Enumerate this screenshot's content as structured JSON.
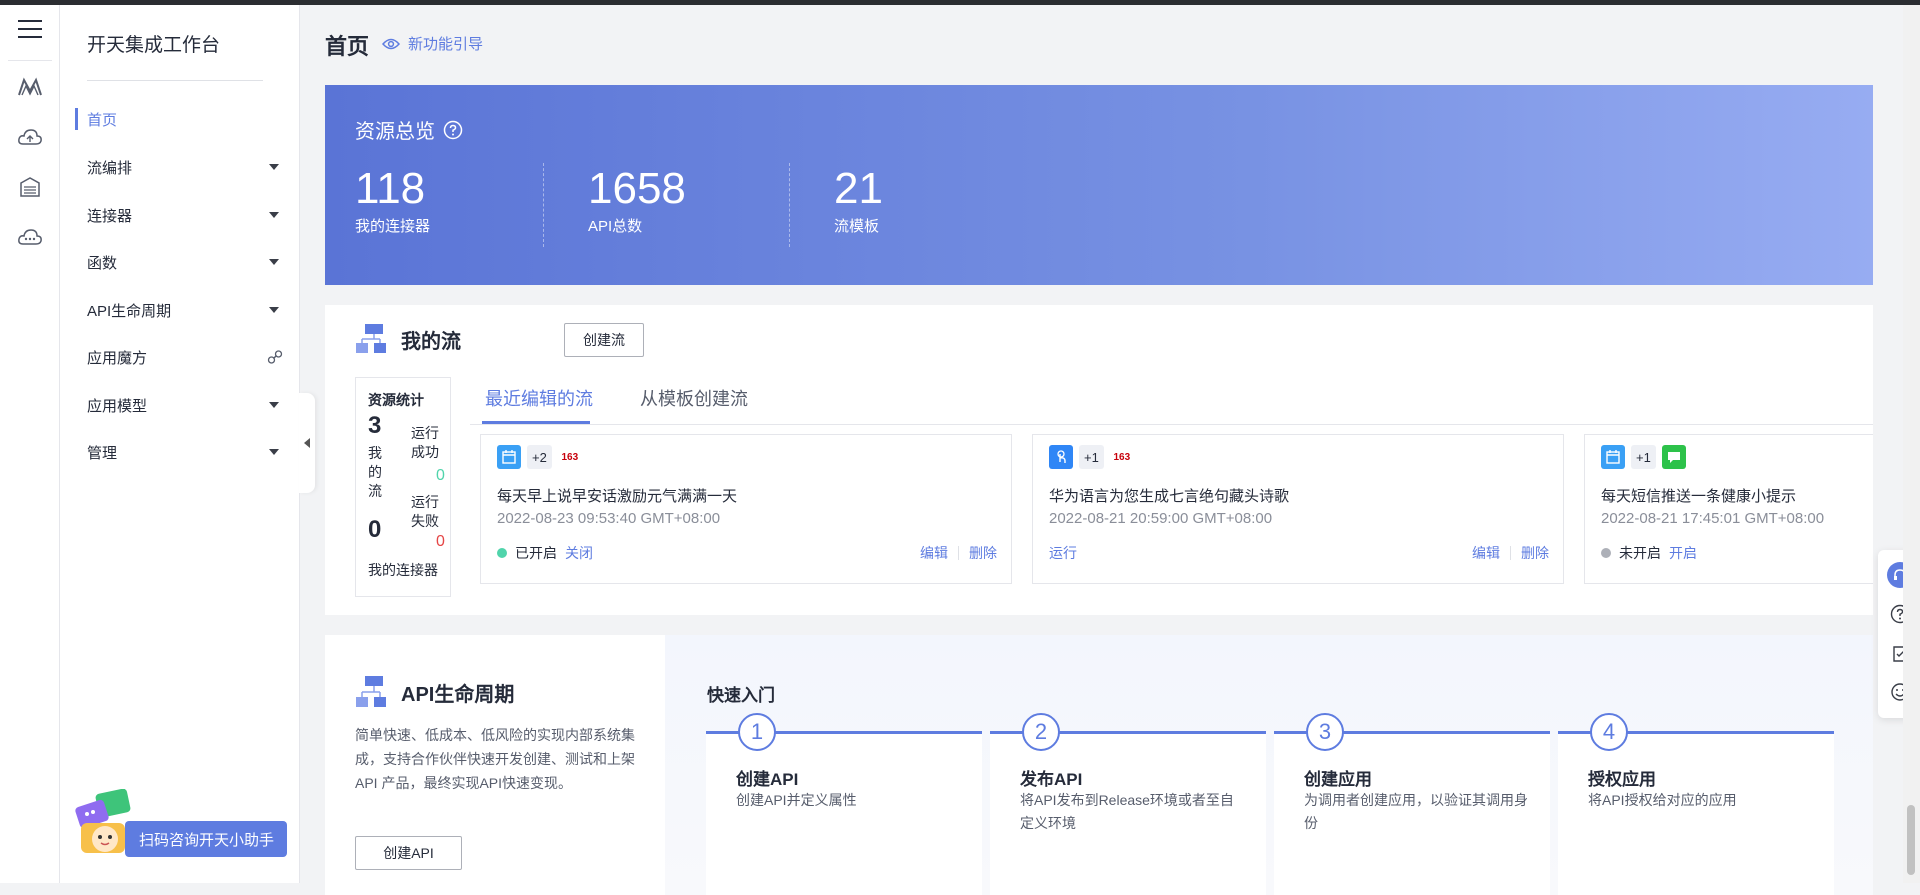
{
  "rail": {
    "icons": [
      "hamburger-icon",
      "m-logo-icon",
      "cloud-upload-icon",
      "server-icon",
      "cloud-icon"
    ]
  },
  "menu": {
    "title": "开天集成工作台",
    "items": [
      {
        "label": "首页"
      },
      {
        "label": "流编排"
      },
      {
        "label": "连接器"
      },
      {
        "label": "函数"
      },
      {
        "label": "API生命周期"
      },
      {
        "label": "应用魔方"
      },
      {
        "label": "应用模型"
      },
      {
        "label": "管理"
      }
    ],
    "assistant": "扫码咨询开天小助手"
  },
  "header": {
    "title": "首页",
    "guide": "新功能引导"
  },
  "overview": {
    "title": "资源总览",
    "stats": [
      {
        "value": "118",
        "label": "我的连接器"
      },
      {
        "value": "1658",
        "label": "API总数"
      },
      {
        "value": "21",
        "label": "流模板"
      }
    ]
  },
  "flows": {
    "title": "我的流",
    "create_btn": "创建流",
    "res": {
      "title": "资源统计",
      "flow_count": "3",
      "flow_label": "我的流",
      "conn_count": "0",
      "conn_label": "我的连接器",
      "success_label": "运行成功",
      "success_count": "0",
      "fail_label": "运行失败",
      "fail_count": "0"
    },
    "tabs": [
      "最近编辑的流",
      "从模板创建流"
    ],
    "cards": [
      {
        "plus": "+2",
        "badge": "163",
        "name": "每天早上说早安话激励元气满满一天",
        "time": "2022-08-23 09:53:40 GMT+08:00",
        "status": "已开启",
        "toggle": "关闭",
        "edit": "编辑",
        "del": "删除",
        "status_color": "#50d4ab"
      },
      {
        "plus": "+1",
        "badge": "163",
        "name": "华为语言为您生成七言绝句藏头诗歌",
        "time": "2022-08-21 20:59:00 GMT+08:00",
        "run": "运行",
        "edit": "编辑",
        "del": "删除"
      },
      {
        "plus": "+1",
        "name": "每天短信推送一条健康小提示",
        "time": "2022-08-21 17:45:01 GMT+08:00",
        "status": "未开启",
        "toggle": "开启",
        "status_color": "#adb0b8"
      }
    ]
  },
  "api": {
    "title": "API生命周期",
    "desc": "简单快速、低成本、低风险的实现内部系统集成，支持合作伙伴快速开发创建、测试和上架API 产品，最终实现API快速变现。",
    "create_btn": "创建API",
    "quick_title": "快速入门",
    "steps": [
      {
        "num": "1",
        "title": "创建API",
        "desc": "创建API并定义属性"
      },
      {
        "num": "2",
        "title": "发布API",
        "desc": "将API发布到Release环境或者至自定义环境"
      },
      {
        "num": "3",
        "title": "创建应用",
        "desc": "为调用者创建应用，以验证其调用身份"
      },
      {
        "num": "4",
        "title": "授权应用",
        "desc": "将API授权给对应的应用"
      }
    ]
  },
  "floatbar": {
    "icons": [
      "headset-icon",
      "help-icon",
      "feedback-icon",
      "smile-icon"
    ]
  },
  "colors": {
    "accent": "#5e7ce0",
    "success": "#50d4ab",
    "danger": "#e54545"
  }
}
